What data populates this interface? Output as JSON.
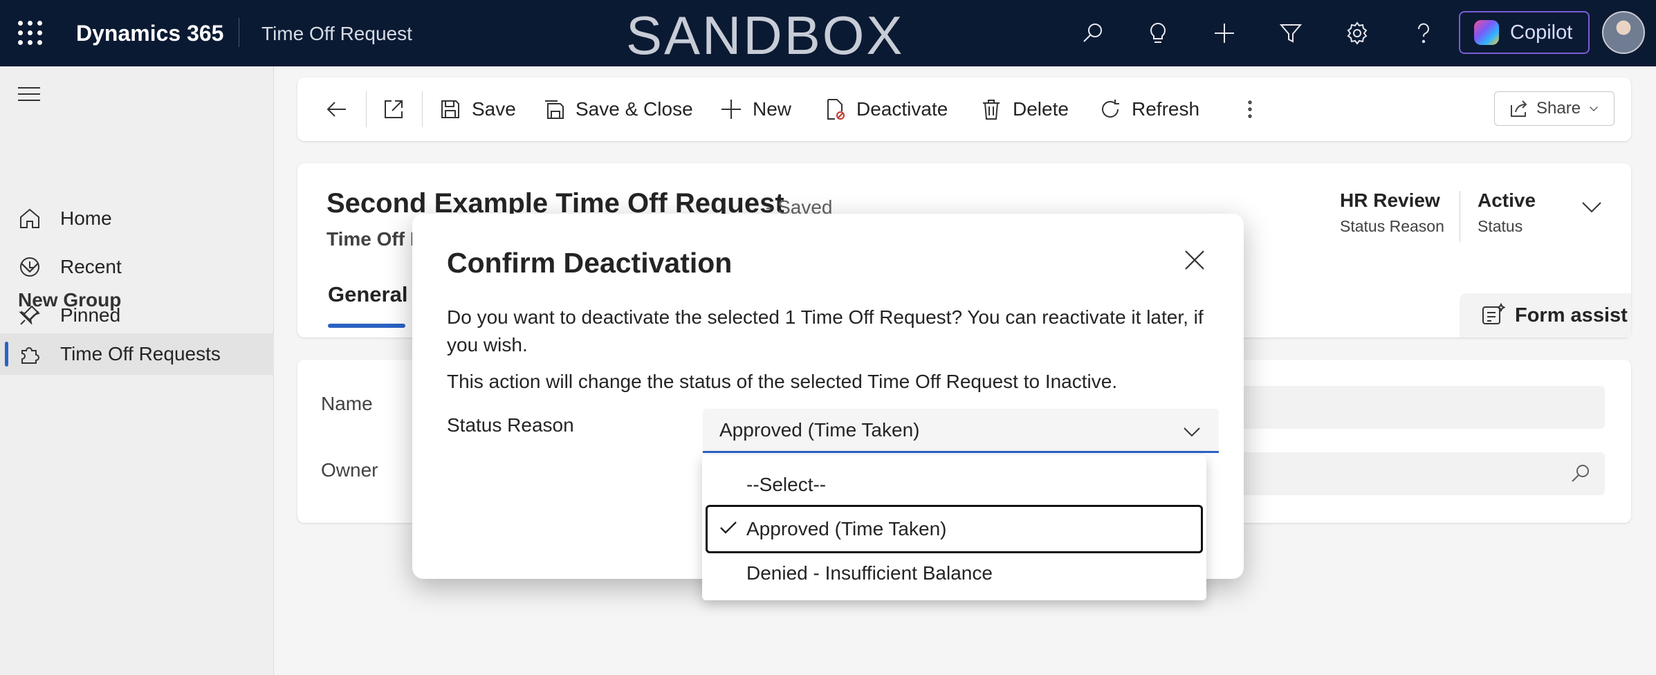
{
  "topbar": {
    "brand": "Dynamics 365",
    "app_name": "Time Off Request",
    "environment": "SANDBOX",
    "copilot_label": "Copilot",
    "icons": [
      "search-icon",
      "lightbulb-icon",
      "plus-icon",
      "filter-icon",
      "gear-icon",
      "help-icon"
    ]
  },
  "sidebar": {
    "items": [
      {
        "label": "Home",
        "icon": "home-icon"
      },
      {
        "label": "Recent",
        "icon": "clock-icon"
      },
      {
        "label": "Pinned",
        "icon": "pin-icon"
      }
    ],
    "group_label": "New Group",
    "group_items": [
      {
        "label": "Time Off Requests",
        "icon": "puzzle-icon"
      }
    ]
  },
  "commandbar": {
    "save": "Save",
    "save_close": "Save & Close",
    "new": "New",
    "deactivate": "Deactivate",
    "delete": "Delete",
    "refresh": "Refresh",
    "share": "Share"
  },
  "record": {
    "title": "Second Example Time Off Request",
    "saved_state": "- Saved",
    "entity": "Time Off R",
    "tab_general": "General",
    "status_reason_value": "HR Review",
    "status_reason_label": "Status Reason",
    "status_value": "Active",
    "status_label": "Status",
    "form_assist": "Form assist",
    "fields": {
      "name_label": "Name",
      "owner_label": "Owner"
    }
  },
  "dialog": {
    "title": "Confirm Deactivation",
    "message_1": "Do you want to deactivate the selected 1 Time Off Request? You can reactivate it later, if you wish.",
    "message_2": "This action will change the status of the selected Time Off Request to Inactive.",
    "status_reason_label": "Status Reason",
    "status_reason_selected": "Approved (Time Taken)",
    "options": [
      "--Select--",
      "Approved (Time Taken)",
      "Denied - Insufficient Balance"
    ]
  },
  "colors": {
    "topbar_bg": "#0b1a33",
    "accent": "#2b63c4",
    "copilot_border": "#7b5cd6"
  }
}
